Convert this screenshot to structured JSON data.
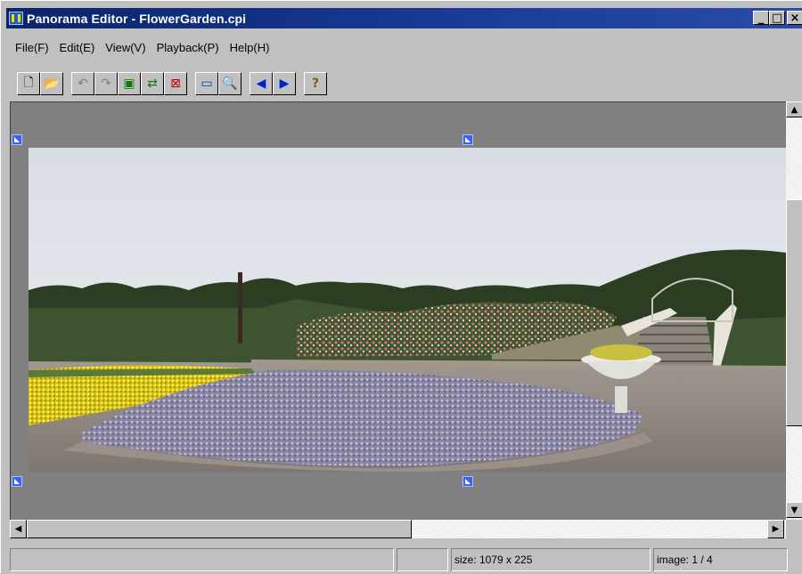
{
  "window": {
    "title": "Panorama Editor - FlowerGarden.cpi"
  },
  "title_buttons": {
    "minimize": "_",
    "maximize": "□",
    "close": "×"
  },
  "menu": [
    {
      "label": "File(F)"
    },
    {
      "label": "Edit(E)"
    },
    {
      "label": "View(V)"
    },
    {
      "label": "Playback(P)"
    },
    {
      "label": "Help(H)"
    }
  ],
  "toolbar": [
    {
      "icon": "new-file-icon",
      "glyph": "🗋"
    },
    {
      "icon": "open-folder-icon",
      "glyph": "📂"
    },
    {
      "icon": "undo-icon",
      "glyph": "↶",
      "enabled": false
    },
    {
      "icon": "redo-icon",
      "glyph": "↷",
      "enabled": false
    },
    {
      "icon": "insert-image-icon",
      "glyph": "▣"
    },
    {
      "icon": "swap-images-icon",
      "glyph": "⇄"
    },
    {
      "icon": "delete-image-icon",
      "glyph": "⊠"
    },
    {
      "icon": "preview-image-icon",
      "glyph": "▭"
    },
    {
      "icon": "zoom-icon",
      "glyph": "🔍"
    },
    {
      "icon": "previous-icon",
      "glyph": "◀"
    },
    {
      "icon": "next-icon",
      "glyph": "▶"
    },
    {
      "icon": "help-icon",
      "glyph": "?"
    }
  ],
  "scrollbars": {
    "up": "▲",
    "down": "▼",
    "left": "◀",
    "right": "▶"
  },
  "status": {
    "pane1": "",
    "pane2": "",
    "size": "size: 1079 x 225",
    "image": "image: 1 / 4"
  },
  "colors": {
    "titlebar": "#0a246a",
    "workspace": "#808080",
    "marker": "#3a63f0"
  }
}
